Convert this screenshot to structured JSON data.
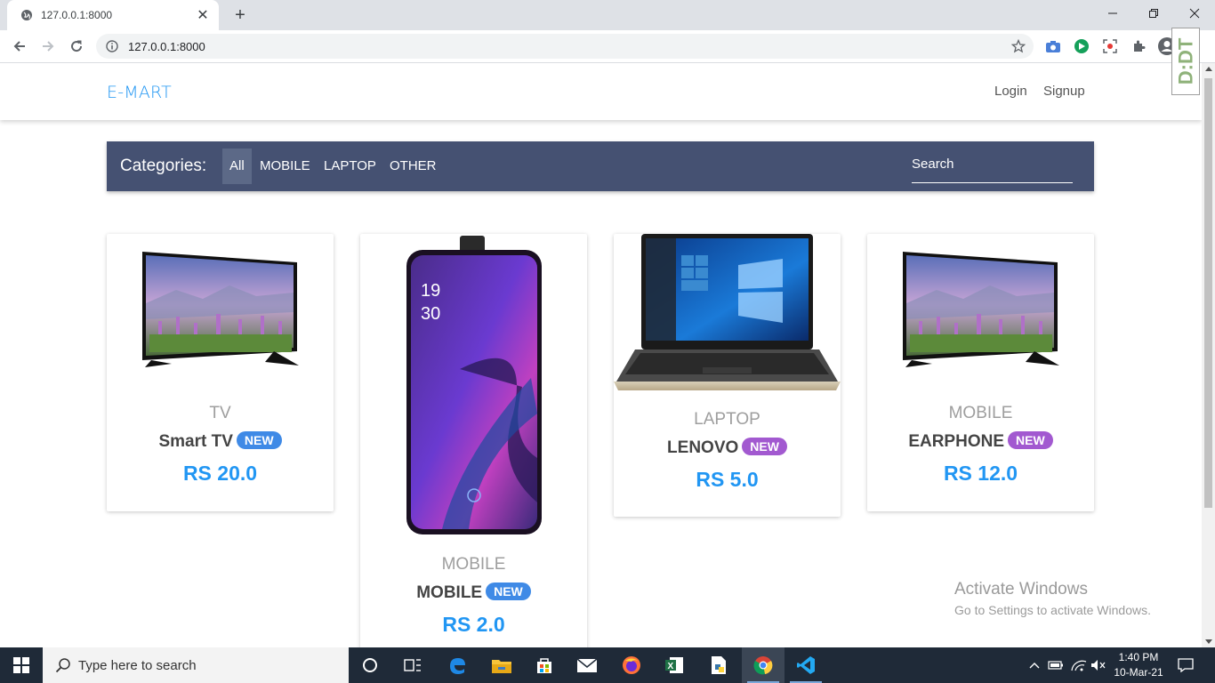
{
  "browser": {
    "tab_title": "127.0.0.1:8000",
    "url": "127.0.0.1:8000"
  },
  "navbar": {
    "brand": "E-MART",
    "login": "Login",
    "signup": "Signup"
  },
  "extension_badge": "D:DT",
  "categories": {
    "title": "Categories:",
    "items": [
      {
        "label": "All",
        "active": true
      },
      {
        "label": "MOBILE",
        "active": false
      },
      {
        "label": "LAPTOP",
        "active": false
      },
      {
        "label": "OTHER",
        "active": false
      }
    ],
    "search_placeholder": "Search"
  },
  "products": [
    {
      "category": "TV",
      "name": "Smart TV",
      "badge": "NEW",
      "badge_color": "#3f8ae6",
      "price": "RS 20.0",
      "image": "tv-image"
    },
    {
      "category": "MOBILE",
      "name": "MOBILE",
      "badge": "NEW",
      "badge_color": "#3f8ae6",
      "price": "RS 2.0",
      "image": "phone-image"
    },
    {
      "category": "LAPTOP",
      "name": "LENOVO",
      "badge": "NEW",
      "badge_color": "#a259d0",
      "price": "RS 5.0",
      "image": "laptop-image"
    },
    {
      "category": "MOBILE",
      "name": "EARPHONE",
      "badge": "NEW",
      "badge_color": "#a259d0",
      "price": "RS 12.0",
      "image": "tv-image"
    }
  ],
  "watermark": {
    "title": "Activate Windows",
    "subtitle": "Go to Settings to activate Windows."
  },
  "taskbar": {
    "search_placeholder": "Type here to search",
    "time": "1:40 PM",
    "date": "10-Mar-21"
  },
  "colors": {
    "accent": "#2196f3",
    "catbar": "#455172",
    "badge_blue": "#3f8ae6",
    "badge_purple": "#a259d0"
  }
}
